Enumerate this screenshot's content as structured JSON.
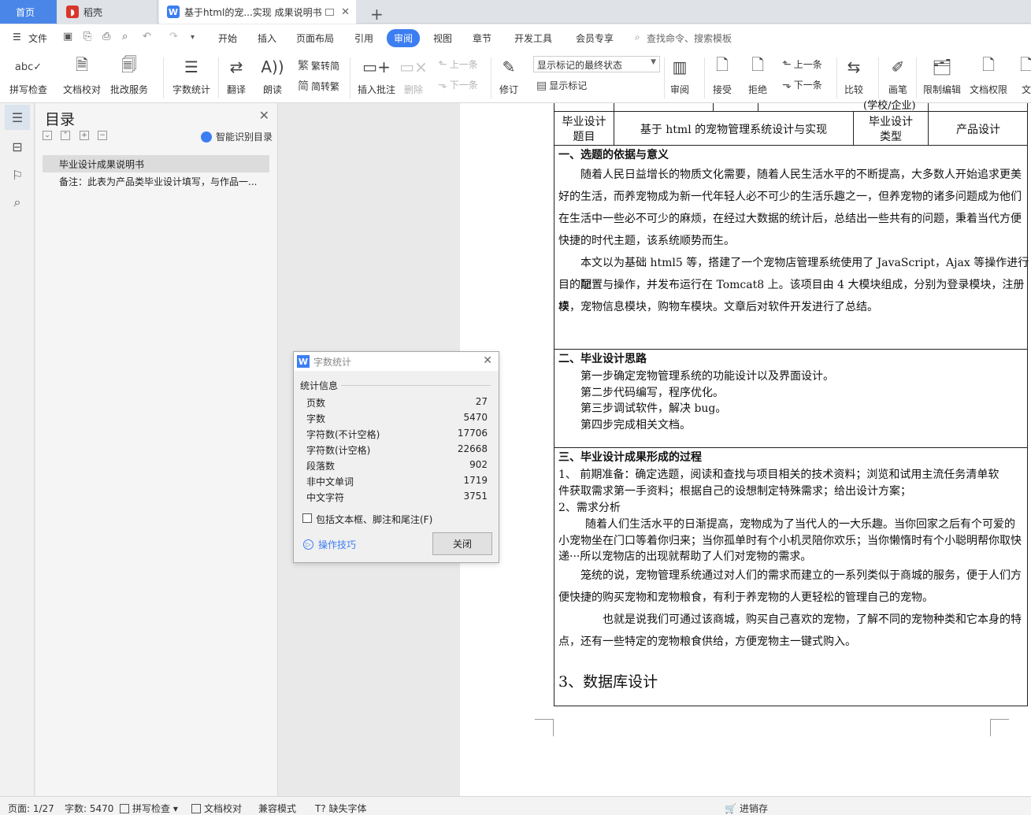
{
  "tabs": {
    "home": "首页",
    "daoke": "稻壳",
    "doc": "基于html的宠...实现 成果说明书"
  },
  "menu": {
    "file": "文件",
    "items": [
      "开始",
      "插入",
      "页面布局",
      "引用",
      "审阅",
      "视图",
      "章节",
      "开发工具",
      "会员专享"
    ],
    "search_placeholder": "查找命令、搜索模板"
  },
  "ribbon": {
    "spellcheck": "拼写检查",
    "doccheck": "文档校对",
    "batch": "批改服务",
    "wordcount": "字数统计",
    "translate": "翻译",
    "read": "朗读",
    "trad": "繁转简",
    "simp": "简转繁",
    "insert_comment": "插入批注",
    "delete": "删除",
    "prev_comment": "上一条",
    "next_comment": "下一条",
    "revise": "修订",
    "markup_select": "显示标记的最终状态",
    "show_markup": "显示标记",
    "review": "审阅",
    "accept": "接受",
    "reject": "拒绝",
    "prev": "上一条",
    "next": "下一条",
    "compare": "比较",
    "pen": "画笔",
    "restrict": "限制编辑",
    "rights": "文档权限",
    "more": "文"
  },
  "toc": {
    "title": "目录",
    "smart": "智能识别目录",
    "item1": "毕业设计成果说明书",
    "item2": "备注：此表为产品类毕业设计填写，与作品一..."
  },
  "doc": {
    "top_cell": "(学校/企业)",
    "row_label1": "毕业设计",
    "row_label1b": "题目",
    "topic": "基于 html 的宠物管理系统设计与实现",
    "row_label2": "毕业设计",
    "row_label2b": "类型",
    "type": "产品设计",
    "s1_title": "一、选题的依据与意义",
    "s1_p1": [
      "随着人民日益增长的物质文化需要，随着人民生活水平的不断提高，大多数人开始追求更美",
      "好的生活，而养宠物成为新一代年轻人必不可少的生活乐趣之一，但养宠物的诸多问题成为他们",
      "在生活中一些必不可少的麻烦，在经过大数据的统计后，总结出一些共有的问题，秉着当代方便",
      "快捷的时代主题，该系统顺势而生。"
    ],
    "s1_p2": [
      "本文以为基础 html5 等，搭建了一个宠物店管理系统使用了 JavaScript，Ajax 等操作进行项",
      "目的配置与操作，并发布运行在 Tomcat8 上。该项目由 4 大模块组成，分别为登录模块，注册模",
      "块，宠物信息模块，购物车模块。文章后对软件开发进行了总结。"
    ],
    "s2_title": "二、毕业设计思路",
    "s2_lines": [
      "第一步确定宠物管理系统的功能设计以及界面设计。",
      "第二步代码编写，程序优化。",
      "第三步调试软件，解决 bug。",
      "第四步完成相关文档。"
    ],
    "s3_title": "三、毕业设计成果形成的过程",
    "s3_l1": "1、  前期准备：确定选题，阅读和查找与项目相关的技术资料；浏览和试用主流任务清单软",
    "s3_l2": "件获取需求第一手资料；根据自己的设想制定特殊需求；给出设计方案；",
    "s3_l3": "2、需求分析",
    "s3_p1": [
      "随着人们生活水平的日渐提高，宠物成为了当代人的一大乐趣。当你回家之后有个可爱的",
      "小宠物坐在门口等着你归来；当你孤单时有个小机灵陪你欢乐；当你懒惰时有个小聪明帮你取快",
      "递···所以宠物店的出现就帮助了人们对宠物的需求。"
    ],
    "s3_p2": [
      "笼统的说，宠物管理系统通过对人们的需求而建立的一系列类似于商城的服务，便于人们方",
      "便快捷的购买宠物和宠物粮食，有利于养宠物的人更轻松的管理自己的宠物。"
    ],
    "s3_p3": [
      "也就是说我们可通过该商城，购买自己喜欢的宠物，了解不同的宠物种类和它本身的特",
      "点，还有一些特定的宠物粮食供给，方便宠物主一键式购入。"
    ],
    "s3_heading": "3、数据库设计"
  },
  "dialog": {
    "title": "字数统计",
    "section": "统计信息",
    "stats": [
      {
        "label": "页数",
        "value": "27"
      },
      {
        "label": "字数",
        "value": "5470"
      },
      {
        "label": "字符数(不计空格)",
        "value": "17706"
      },
      {
        "label": "字符数(计空格)",
        "value": "22668"
      },
      {
        "label": "段落数",
        "value": "902"
      },
      {
        "label": "非中文单词",
        "value": "1719"
      },
      {
        "label": "中文字符",
        "value": "3751"
      }
    ],
    "checkbox_label": "包括文本框、脚注和尾注(F)",
    "tips": "操作技巧",
    "close": "关闭"
  },
  "status": {
    "page": "页面: 1/27",
    "words": "字数: 5470",
    "spell": "拼写检查",
    "check": "文档校对",
    "compat": "兼容模式",
    "font": "缺失字体",
    "progress": "进销存"
  },
  "colors": {
    "accent": "#3c7ef2",
    "home_tab": "#4a86e8",
    "daoke_icon": "#d9362b"
  }
}
